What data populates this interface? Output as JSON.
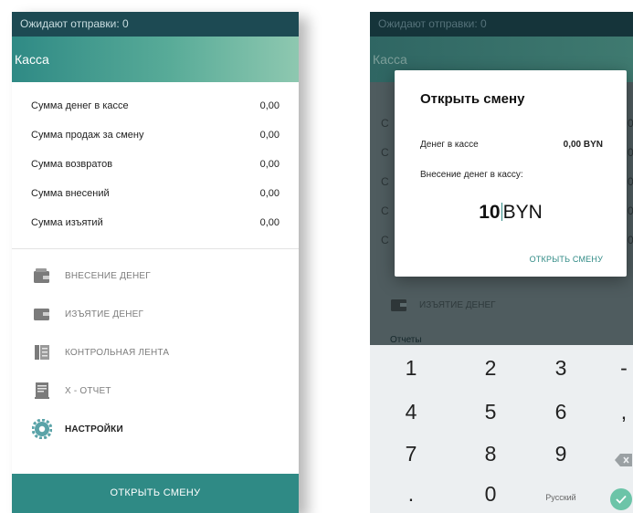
{
  "left": {
    "status": "Ожидают отправки: 0",
    "header_title": "Касса",
    "sums": [
      {
        "label": "Сумма денег в кассе",
        "value": "0,00"
      },
      {
        "label": "Сумма продаж за смену",
        "value": "0,00"
      },
      {
        "label": "Сумма возвратов",
        "value": "0,00"
      },
      {
        "label": "Сумма внесений",
        "value": "0,00"
      },
      {
        "label": "Сумма изъятий",
        "value": "0,00"
      }
    ],
    "menu": [
      {
        "label": "ВНЕСЕНИЕ ДЕНЕГ",
        "icon": "wallet-in-icon"
      },
      {
        "label": "ИЗЪЯТИЕ ДЕНЕГ",
        "icon": "wallet-out-icon"
      },
      {
        "label": "КОНТРОЛЬНАЯ ЛЕНТА",
        "icon": "tape-icon"
      },
      {
        "label": "X - ОТЧЕТ",
        "icon": "report-icon"
      },
      {
        "label": "НАСТРОЙКИ",
        "icon": "gear-icon"
      }
    ],
    "open_shift_button": "ОТКРЫТЬ СМЕНУ"
  },
  "right": {
    "status": "Ожидают отправки: 0",
    "header_title": "Касса",
    "bg_menu_label": "ИЗЪЯТИЕ ДЕНЕГ",
    "bg_section": "Отчеты",
    "dialog": {
      "title": "Открыть смену",
      "cash_label": "Денег в кассе",
      "cash_value": "0,00 BYN",
      "deposit_label": "Внесение денег в кассу:",
      "amount": "10",
      "currency": "BYN",
      "confirm_button": "ОТКРЫТЬ СМЕНУ"
    },
    "keyboard": {
      "keys": [
        "1",
        "2",
        "3",
        "-",
        "4",
        "5",
        "6",
        ",",
        "7",
        "8",
        "9",
        "0",
        "."
      ],
      "language": "Русский"
    }
  },
  "colors": {
    "accent": "#2f8a85",
    "status_bar": "#1d4a53",
    "dim_overlay": "#4f5c5f"
  }
}
